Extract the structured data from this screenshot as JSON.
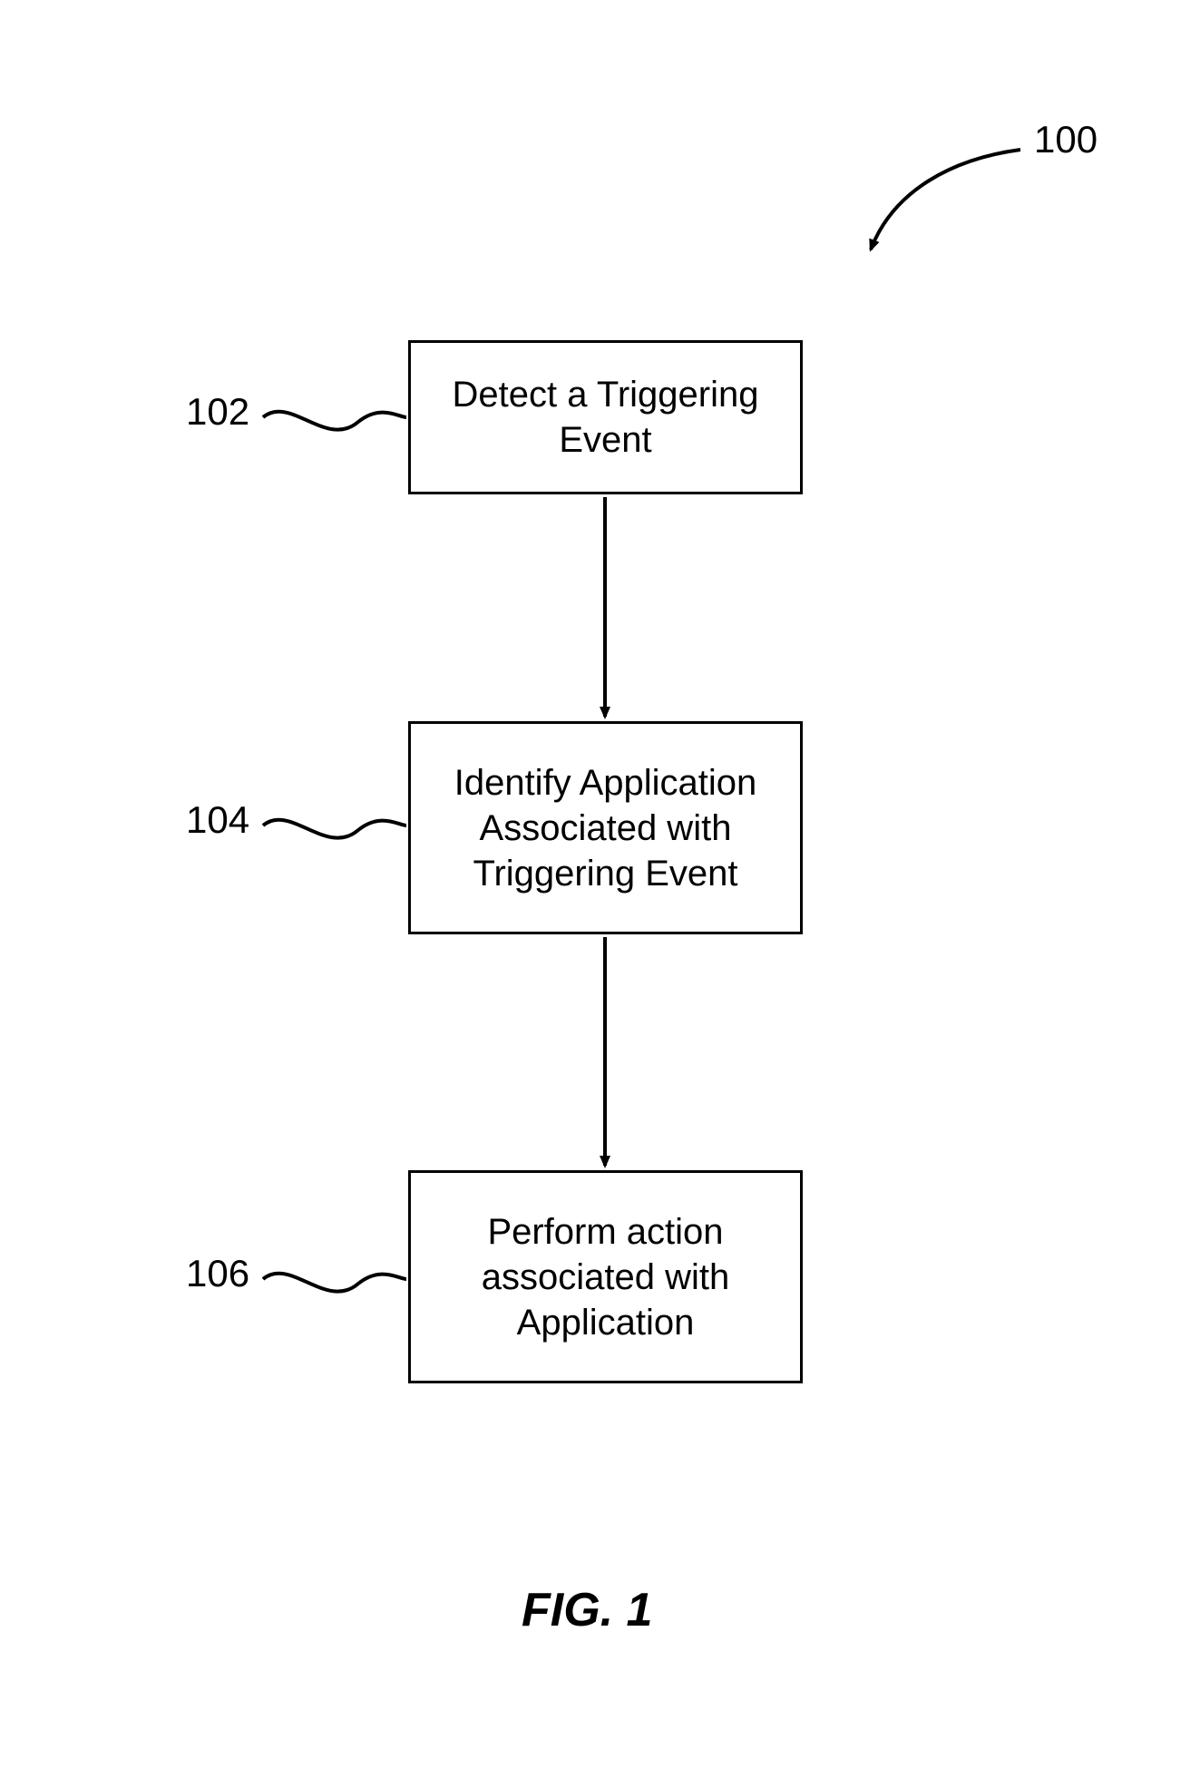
{
  "figure": {
    "ref_number": "100",
    "caption": "FIG. 1",
    "steps": [
      {
        "ref": "102",
        "text": "Detect a Triggering Event"
      },
      {
        "ref": "104",
        "text": "Identify Application Associated with Triggering Event"
      },
      {
        "ref": "106",
        "text": "Perform action associated with Application"
      }
    ]
  }
}
